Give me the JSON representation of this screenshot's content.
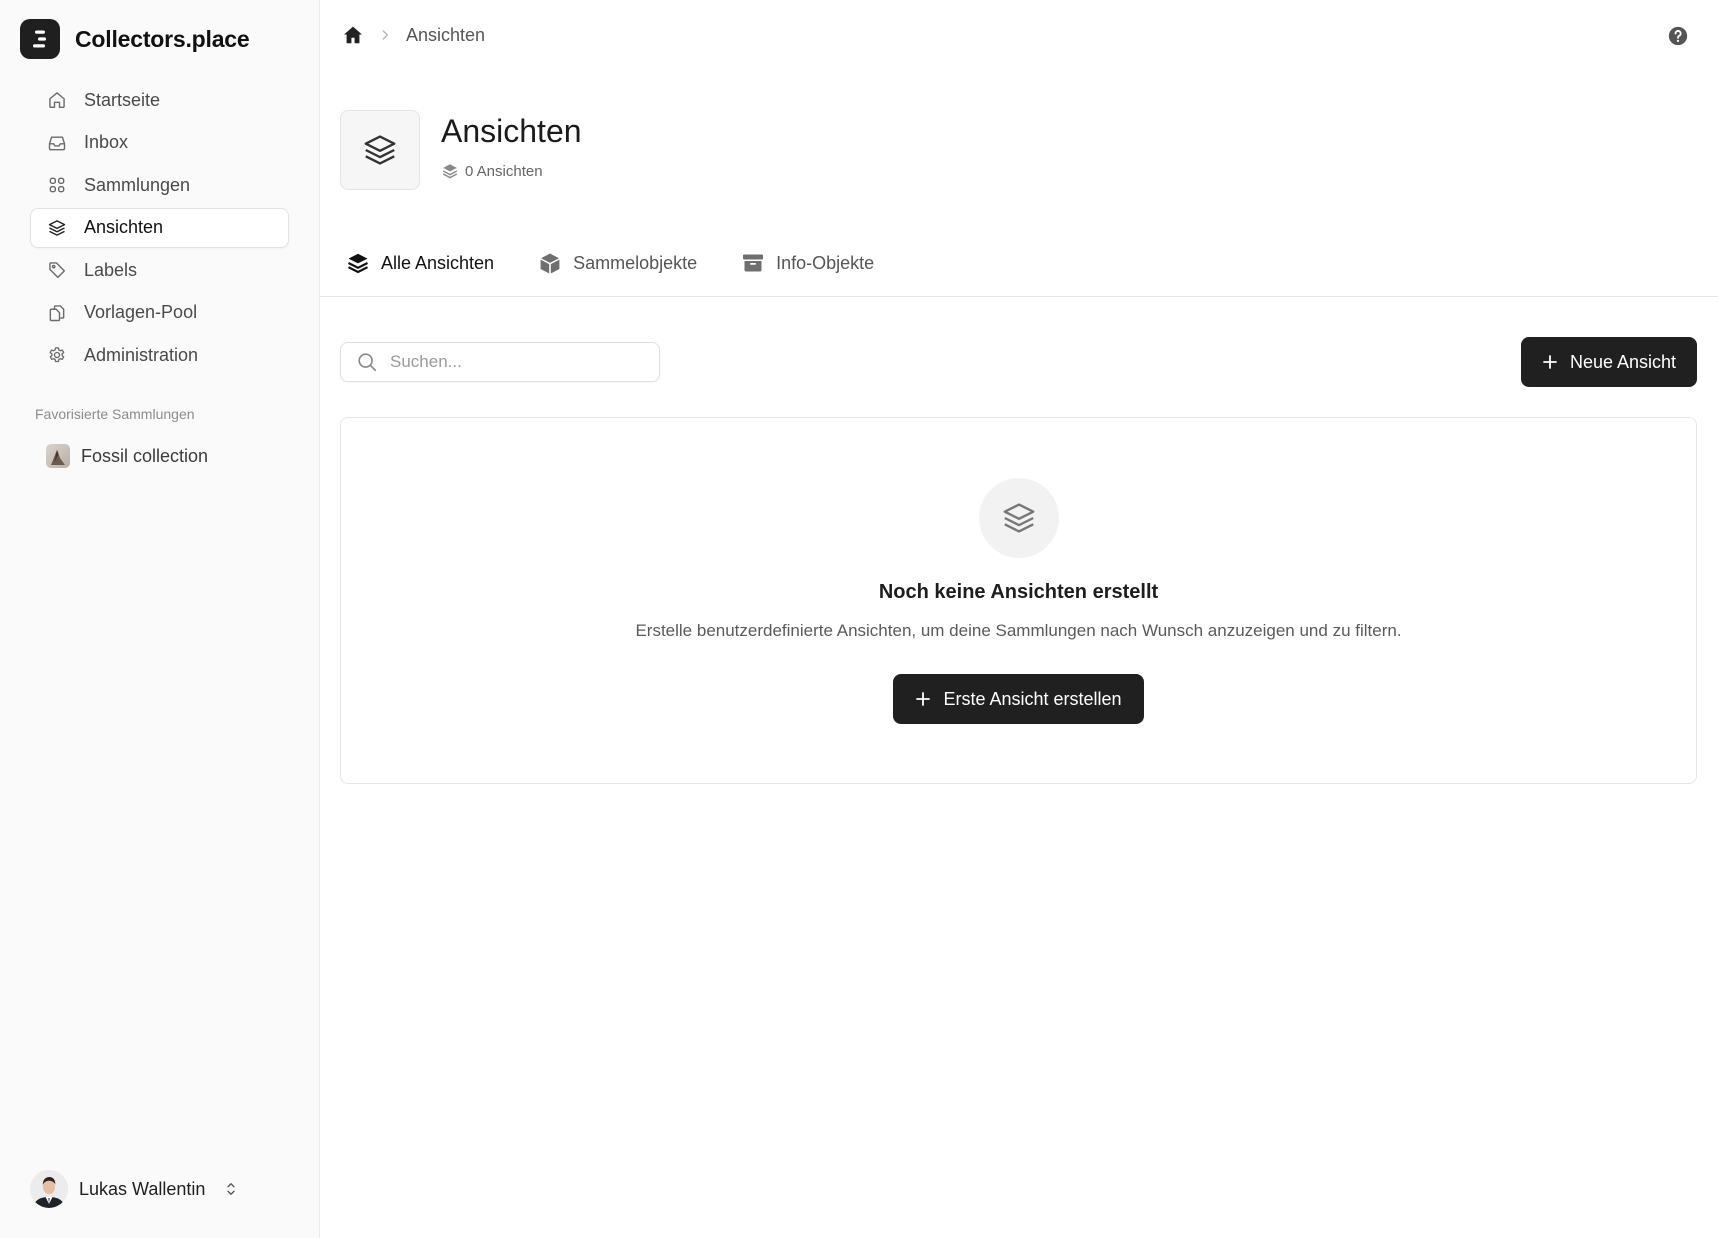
{
  "brand": {
    "name": "Collectors.place"
  },
  "sidebar": {
    "items": [
      {
        "label": "Startseite",
        "icon": "home-icon"
      },
      {
        "label": "Inbox",
        "icon": "inbox-icon"
      },
      {
        "label": "Sammlungen",
        "icon": "grid-icon"
      },
      {
        "label": "Ansichten",
        "icon": "layers-icon",
        "active": true
      },
      {
        "label": "Labels",
        "icon": "tag-icon"
      },
      {
        "label": "Vorlagen-Pool",
        "icon": "copy-icon"
      },
      {
        "label": "Administration",
        "icon": "gear-icon"
      }
    ],
    "favorites_heading": "Favorisierte Sammlungen",
    "favorites": [
      {
        "label": "Fossil collection"
      }
    ],
    "user": {
      "name": "Lukas Wallentin"
    }
  },
  "breadcrumb": {
    "current": "Ansichten"
  },
  "header": {
    "title": "Ansichten",
    "count_label": "0 Ansichten"
  },
  "tabs": [
    {
      "label": "Alle Ansichten",
      "icon": "layers-filled-icon",
      "active": true
    },
    {
      "label": "Sammelobjekte",
      "icon": "cube-icon"
    },
    {
      "label": "Info-Objekte",
      "icon": "archive-icon"
    }
  ],
  "search": {
    "placeholder": "Suchen...",
    "value": ""
  },
  "toolbar": {
    "new_label": "Neue Ansicht"
  },
  "empty_state": {
    "title": "Noch keine Ansichten erstellt",
    "description": "Erstelle benutzerdefinierte Ansichten, um deine Sammlungen nach Wunsch anzuzeigen und zu filtern.",
    "button_label": "Erste Ansicht erstellen"
  },
  "colors": {
    "primary": "#202020",
    "sidebar_bg": "#fafafa",
    "border": "#e6e6e6"
  }
}
